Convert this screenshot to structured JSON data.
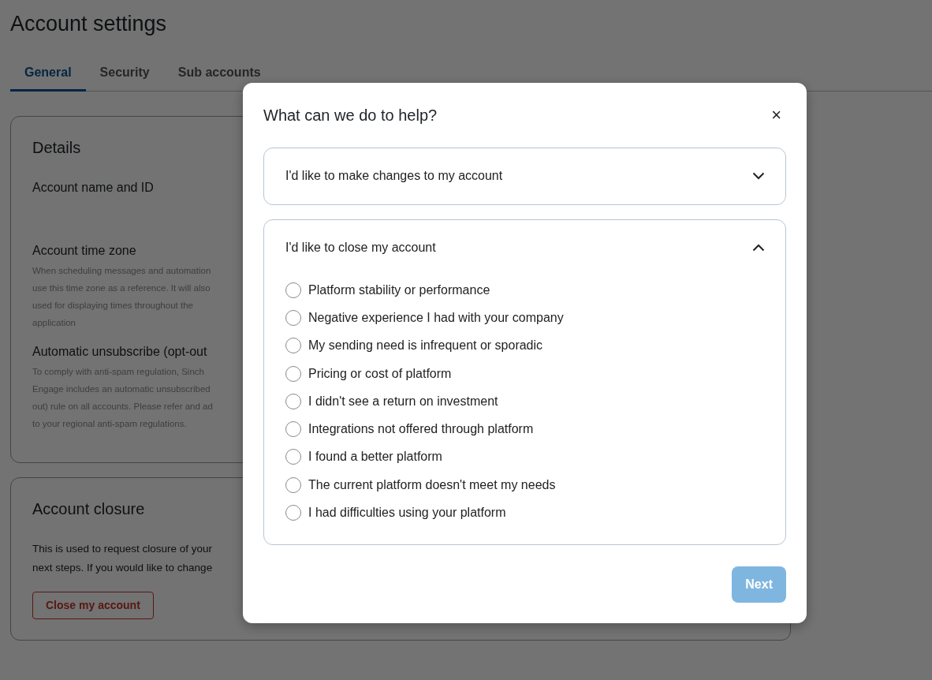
{
  "page": {
    "title": "Account settings"
  },
  "tabs": [
    {
      "label": "General",
      "selected": true
    },
    {
      "label": "Security",
      "selected": false
    },
    {
      "label": "Sub accounts",
      "selected": false
    }
  ],
  "details_card": {
    "title": "Details",
    "sections": [
      {
        "heading": "Account name and ID"
      },
      {
        "heading": "Account time zone",
        "description": [
          "When scheduling messages and automation",
          "use this time zone as a reference. It will also",
          "used for displaying times throughout the",
          "application"
        ]
      },
      {
        "heading": "Automatic unsubscribe (opt-out",
        "description": [
          "To comply with anti-spam regulation, Sinch",
          "Engage includes an automatic unsubscribed",
          "out) rule on all accounts. Please refer and ad",
          "to your regional anti-spam regulations."
        ]
      }
    ]
  },
  "closure_card": {
    "title": "Account closure",
    "text": [
      "This is used to request closure of your",
      "next steps. If you would like to change"
    ],
    "button": "Close my account"
  },
  "modal": {
    "title": "What can we do to help?",
    "close": "×",
    "accordion": [
      {
        "label": "I'd like to make changes to my account",
        "expanded": false
      },
      {
        "label": "I'd like to close my account",
        "expanded": true,
        "options": [
          {
            "label": "Platform stability or performance",
            "selected": false
          },
          {
            "label": "Negative experience I had with your company",
            "selected": false
          },
          {
            "label": "My sending need is infrequent or sporadic",
            "selected": false
          },
          {
            "label": "Pricing or cost of platform",
            "selected": false
          },
          {
            "label": "I didn't see a return on investment",
            "selected": false
          },
          {
            "label": "Integrations not offered through platform",
            "selected": false
          },
          {
            "label": "I found a better platform",
            "selected": false
          },
          {
            "label": "The current platform doesn't meet my needs",
            "selected": false
          },
          {
            "label": "I had difficulties using your platform",
            "selected": false
          }
        ]
      }
    ],
    "next_button": {
      "label": "Next",
      "disabled": true
    }
  }
}
